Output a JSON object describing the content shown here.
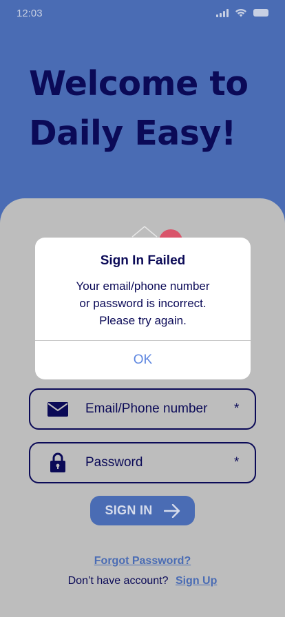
{
  "status_bar": {
    "time": "12:03"
  },
  "welcome": {
    "line1": "Welcome to",
    "line2": "Daily Easy!"
  },
  "form": {
    "email_placeholder": "Email/Phone number",
    "password_placeholder": "Password",
    "required_marker": "*",
    "signin_label": "SIGN IN",
    "forgot_password": "Forgot Password?",
    "no_account_text": "Don’t have account?",
    "signup_label": "Sign Up"
  },
  "dialog": {
    "title": "Sign In Failed",
    "message_line1": "Your email/phone number",
    "message_line2": "or password is incorrect.",
    "message_line3": "Please try again.",
    "ok_label": "OK"
  },
  "colors": {
    "background": "#4a6cb4",
    "heading": "#0b0a57",
    "card": "#bdbdbd",
    "link": "#4a6cb4",
    "dialog_button": "#5d86e0"
  }
}
